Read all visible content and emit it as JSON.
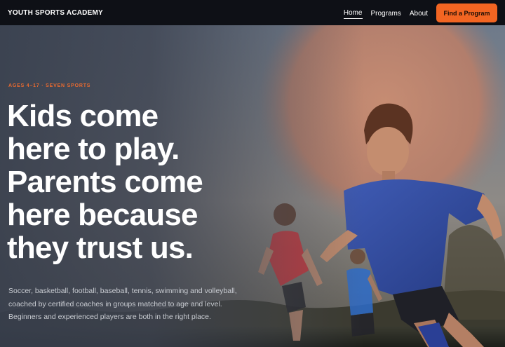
{
  "nav": {
    "brand": "YOUTH SPORTS ACADEMY",
    "links": [
      {
        "label": "Home",
        "active": true
      },
      {
        "label": "Programs",
        "active": false
      },
      {
        "label": "About",
        "active": false
      }
    ],
    "cta_label": "Find a Program"
  },
  "hero": {
    "eyebrow": "AGES 4–17 · SEVEN SPORTS",
    "headline_lines": [
      "Kids come",
      "here to play.",
      "Parents come",
      "here because",
      "they trust us."
    ],
    "subcopy": "Soccer, basketball, football, baseball, tennis, swimming and volleyball, coached by certified coaches in groups matched to age and level. Beginners and experienced players are both in the right place."
  },
  "colors": {
    "accent": "#f26522",
    "eyebrow": "#ea6a2f",
    "nav_bg": "#0e1016"
  }
}
